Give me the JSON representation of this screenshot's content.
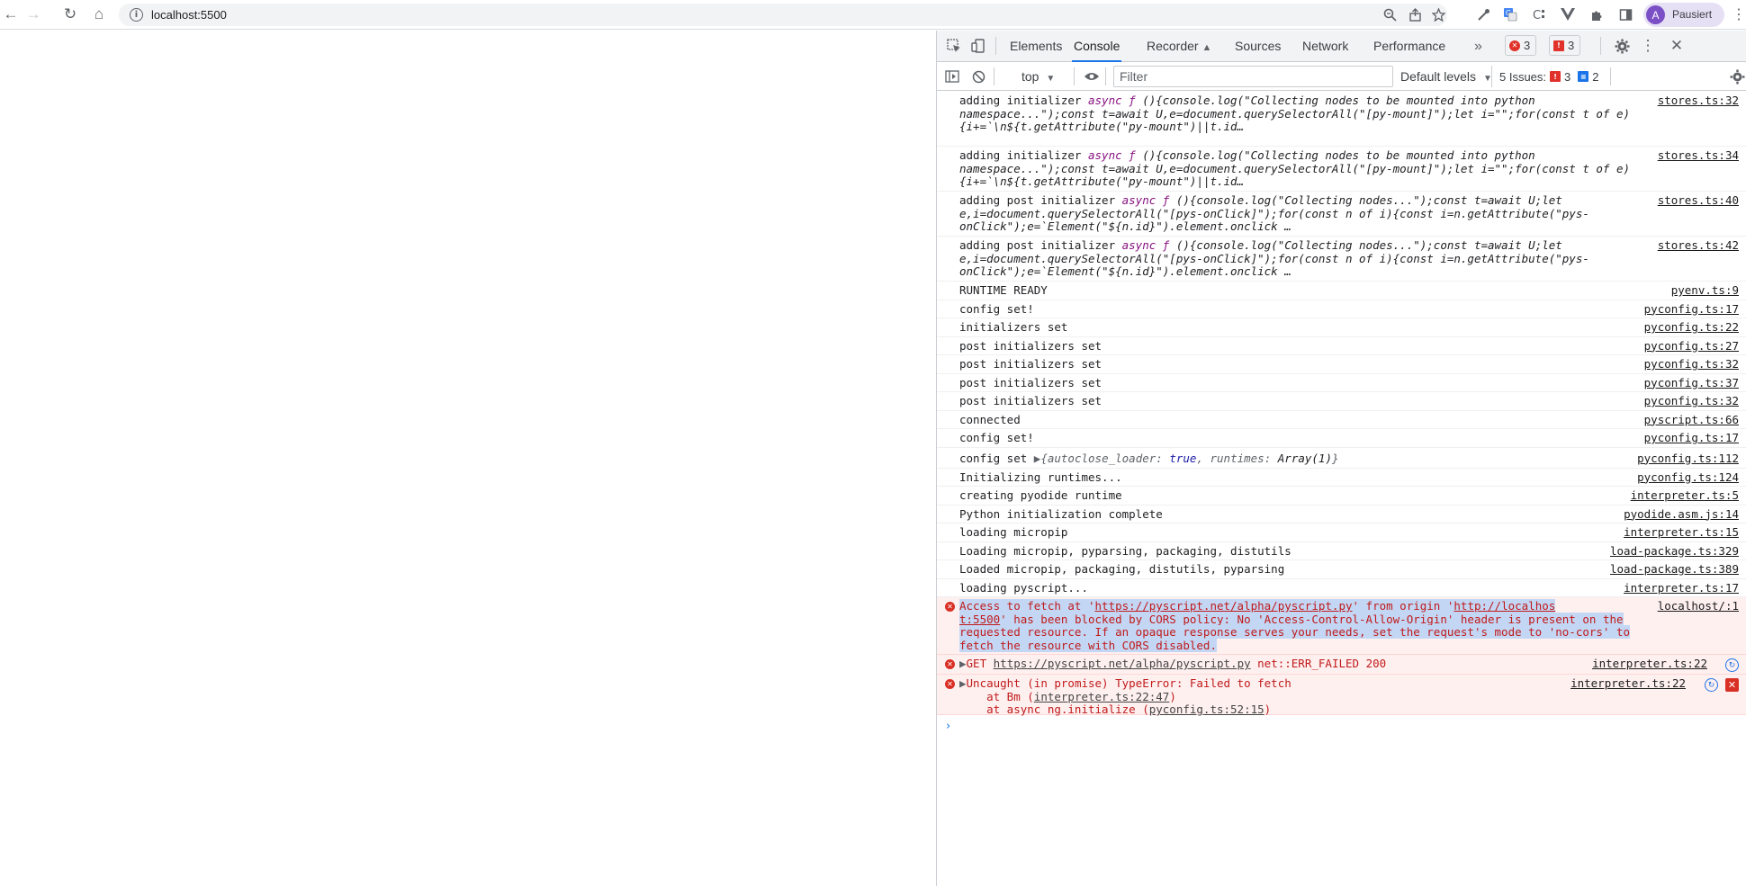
{
  "browser": {
    "url": "localhost:5500",
    "profile": {
      "initial": "A",
      "label": "Pausiert"
    },
    "nav_glyphs": {
      "back": "←",
      "forward": "→",
      "reload": "↻",
      "home": "⌂",
      "info": "i",
      "menu": "⋮"
    }
  },
  "devtools": {
    "tabs": [
      "Elements",
      "Console",
      "Recorder",
      "Sources",
      "Network",
      "Performance"
    ],
    "active_tab": "Console",
    "more_tabs_glyph": "»",
    "error_count": "3",
    "warning_count": "3",
    "console_toolbar": {
      "context": "top",
      "filter_placeholder": "Filter",
      "levels": "Default levels",
      "issues_label": "5 Issues:",
      "issues_errors": "3",
      "issues_info": "2"
    },
    "messages": [
      {
        "line1": "adding initializer",
        "kw": "async ƒ",
        "rest1": " (){console.log(\"Collecting nodes to be mounted into python",
        "line2": "namespace...\");const t=await U,e=document.querySelectorAll(\"[py-mount]\");let i=\"\";for(const t of e)",
        "line3": "{i+=`\\n${t.getAttribute(\"py-mount\")||t.id…",
        "source": "stores.ts:32"
      },
      {
        "line1": "adding initializer",
        "kw": "async ƒ",
        "rest1": " (){console.log(\"Collecting nodes to be mounted into python",
        "line2": "namespace...\");const t=await U,e=document.querySelectorAll(\"[py-mount]\");let i=\"\";for(const t of e)",
        "line3": "{i+=`\\n${t.getAttribute(\"py-mount\")||t.id…",
        "source": "stores.ts:34"
      },
      {
        "line1": "adding post initializer",
        "kw": "async ƒ",
        "rest1": " (){console.log(\"Collecting nodes...\");const t=await U;let",
        "line2": "e,i=document.querySelectorAll(\"[pys-onClick]\");for(const n of i){const i=n.getAttribute(\"pys-",
        "line3": "onClick\");e=`Element(\"${n.id}\").element.onclick …",
        "source": "stores.ts:40"
      },
      {
        "line1": "adding post initializer",
        "kw": "async ƒ",
        "rest1": " (){console.log(\"Collecting nodes...\");const t=await U;let",
        "line2": "e,i=document.querySelectorAll(\"[pys-onClick]\");for(const n of i){const i=n.getAttribute(\"pys-",
        "line3": "onClick\");e=`Element(\"${n.id}\").element.onclick …",
        "source": "stores.ts:42"
      }
    ],
    "simple_messages": [
      {
        "text": "RUNTIME READY",
        "source": "pyenv.ts:9"
      },
      {
        "text": "config set!",
        "source": "pyconfig.ts:17"
      },
      {
        "text": "initializers set",
        "source": "pyconfig.ts:22"
      },
      {
        "text": "post initializers set",
        "source": "pyconfig.ts:27"
      },
      {
        "text": "post initializers set",
        "source": "pyconfig.ts:32"
      },
      {
        "text": "post initializers set",
        "source": "pyconfig.ts:37"
      },
      {
        "text": "post initializers set",
        "source": "pyconfig.ts:32"
      },
      {
        "text": "connected",
        "source": "pyscript.ts:66"
      },
      {
        "text": "config set!",
        "source": "pyconfig.ts:17"
      }
    ],
    "config_obj": {
      "prefix": "config set",
      "key1": "autoclose_loader:",
      "val1": "true",
      "key2": "runtimes:",
      "val2": "Array(1)",
      "source": "pyconfig.ts:112"
    },
    "simple_messages_2": [
      {
        "text": "Initializing runtimes...",
        "source": "pyconfig.ts:124"
      },
      {
        "text": "creating pyodide runtime",
        "source": "interpreter.ts:5"
      },
      {
        "text": "Python initialization complete",
        "source": "pyodide.asm.js:14"
      },
      {
        "text": "loading micropip",
        "source": "interpreter.ts:15"
      },
      {
        "text": "Loading micropip, pyparsing, packaging, distutils",
        "source": "load-package.ts:329"
      },
      {
        "text": "Loaded micropip, packaging, distutils, pyparsing",
        "source": "load-package.ts:389"
      },
      {
        "text": "loading pyscript...",
        "source": "interpreter.ts:17"
      }
    ],
    "cors_error": {
      "a": "Access to fetch at '",
      "url1": "https://pyscript.net/alpha/pyscript.py",
      "b": "' from origin '",
      "url2a": "http://localhos",
      "url2b": "t:5500",
      "c": "' has been blocked by CORS policy: No 'Access-Control-Allow-Origin' header is present on the",
      "d": "requested resource. If an opaque response serves your needs, set the request's mode to 'no-cors' to",
      "e": "fetch the resource with CORS disabled.",
      "source": "localhost/:1"
    },
    "get_error": {
      "method": "GET",
      "url": "https://pyscript.net/alpha/pyscript.py",
      "status": "net::ERR_FAILED 200",
      "source": "interpreter.ts:22"
    },
    "type_error": {
      "line1": "Uncaught (in promise) TypeError: Failed to fetch",
      "line2a": "    at Bm (",
      "line2link": "interpreter.ts:22:47",
      "line2b": ")",
      "line3a": "    at async ng.initialize (",
      "line3link": "pyconfig.ts:52:15",
      "line3b": ")",
      "source": "interpreter.ts:22"
    },
    "prompt": "›"
  }
}
